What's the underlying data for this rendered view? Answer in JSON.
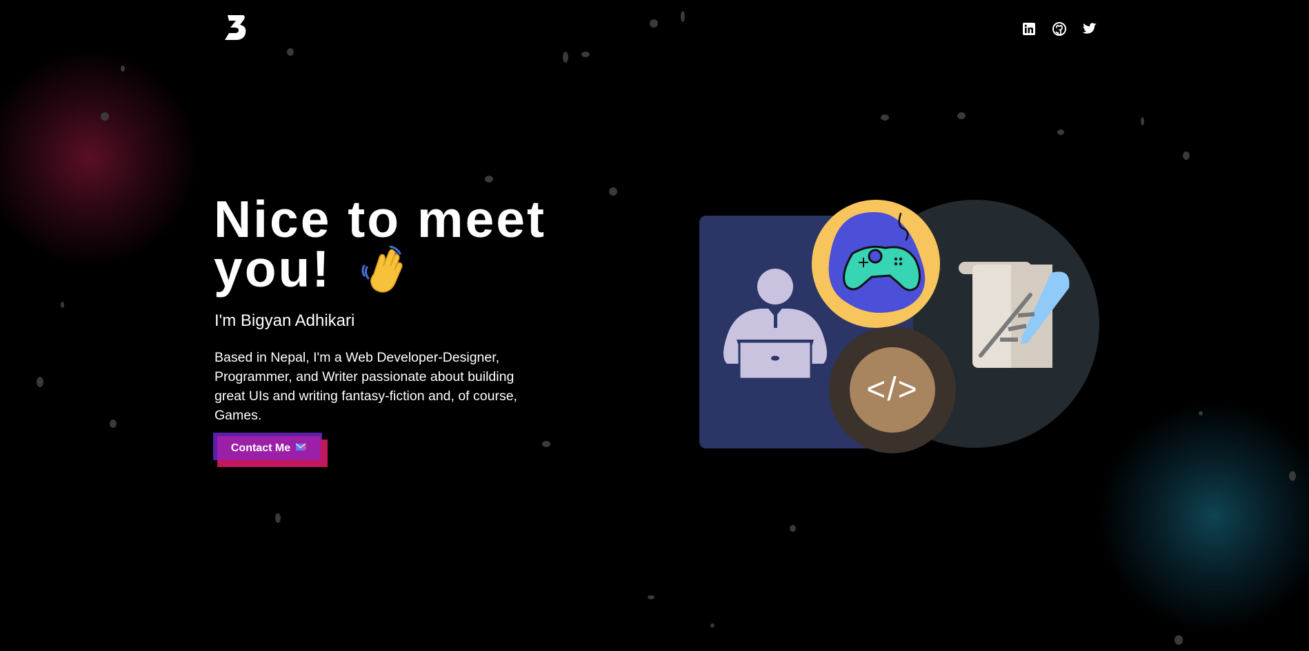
{
  "brand": {
    "logo_letter": "B"
  },
  "socials": [
    {
      "icon": "linkedin-icon",
      "label": "LinkedIn"
    },
    {
      "icon": "github-icon",
      "label": "GitHub"
    },
    {
      "icon": "twitter-icon",
      "label": "Twitter"
    }
  ],
  "hero": {
    "title_line1": "Nice to meet",
    "title_line2": "you!",
    "wave_icon": "waving-hand-icon",
    "subtitle": "I'm Bigyan Adhikari",
    "bio": "Based in Nepal, I'm a Web Developer-Designer, Programmer, and Writer passionate about building great UIs and writing fantasy-fiction and, of course, Games.",
    "contact_label": "Contact Me",
    "contact_icon": "envelope-icon"
  },
  "illustration": {
    "code_text": "</>"
  },
  "colors": {
    "background": "#000000",
    "accent_button": "#9c1fa8",
    "glow_red": "#781432",
    "glow_teal": "#145a6e",
    "panel_blue": "#2b3566",
    "circle_dark": "#232a30",
    "circle_yellow": "#f7c55b",
    "circle_brown": "#3c322c",
    "code_badge": "#a8855e"
  }
}
